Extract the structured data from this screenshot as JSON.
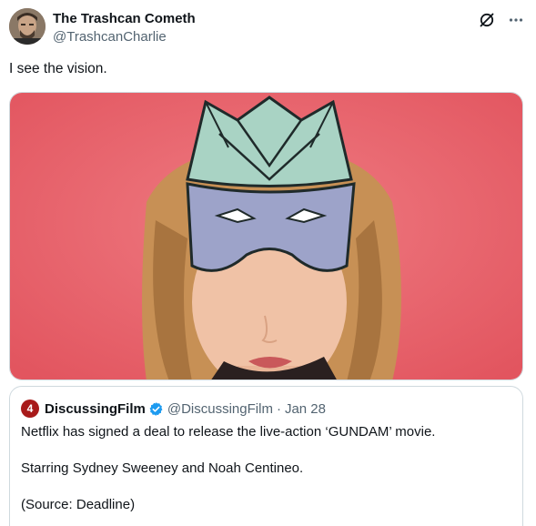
{
  "tweet": {
    "display_name": "The Trashcan Cometh",
    "handle": "@TrashcanCharlie",
    "text": "I see the vision."
  },
  "icons": {
    "avatar": "avatar-photo",
    "grok": "grok-icon",
    "more": "more-icon",
    "verified": "verified-badge-icon"
  },
  "colors": {
    "image_background": "#e8606a",
    "verified_blue": "#1d9bf0",
    "secondary_text": "#536471"
  },
  "quote": {
    "logo_text": "4",
    "name": "DiscussingFilm",
    "handle": "@DiscussingFilm",
    "separator": "·",
    "date": "Jan 28",
    "lines": [
      "Netflix has signed a deal to release the live-action ‘GUNDAM’ movie.",
      "Starring Sydney Sweeney and Noah Centineo.",
      "(Source: Deadline)"
    ]
  }
}
